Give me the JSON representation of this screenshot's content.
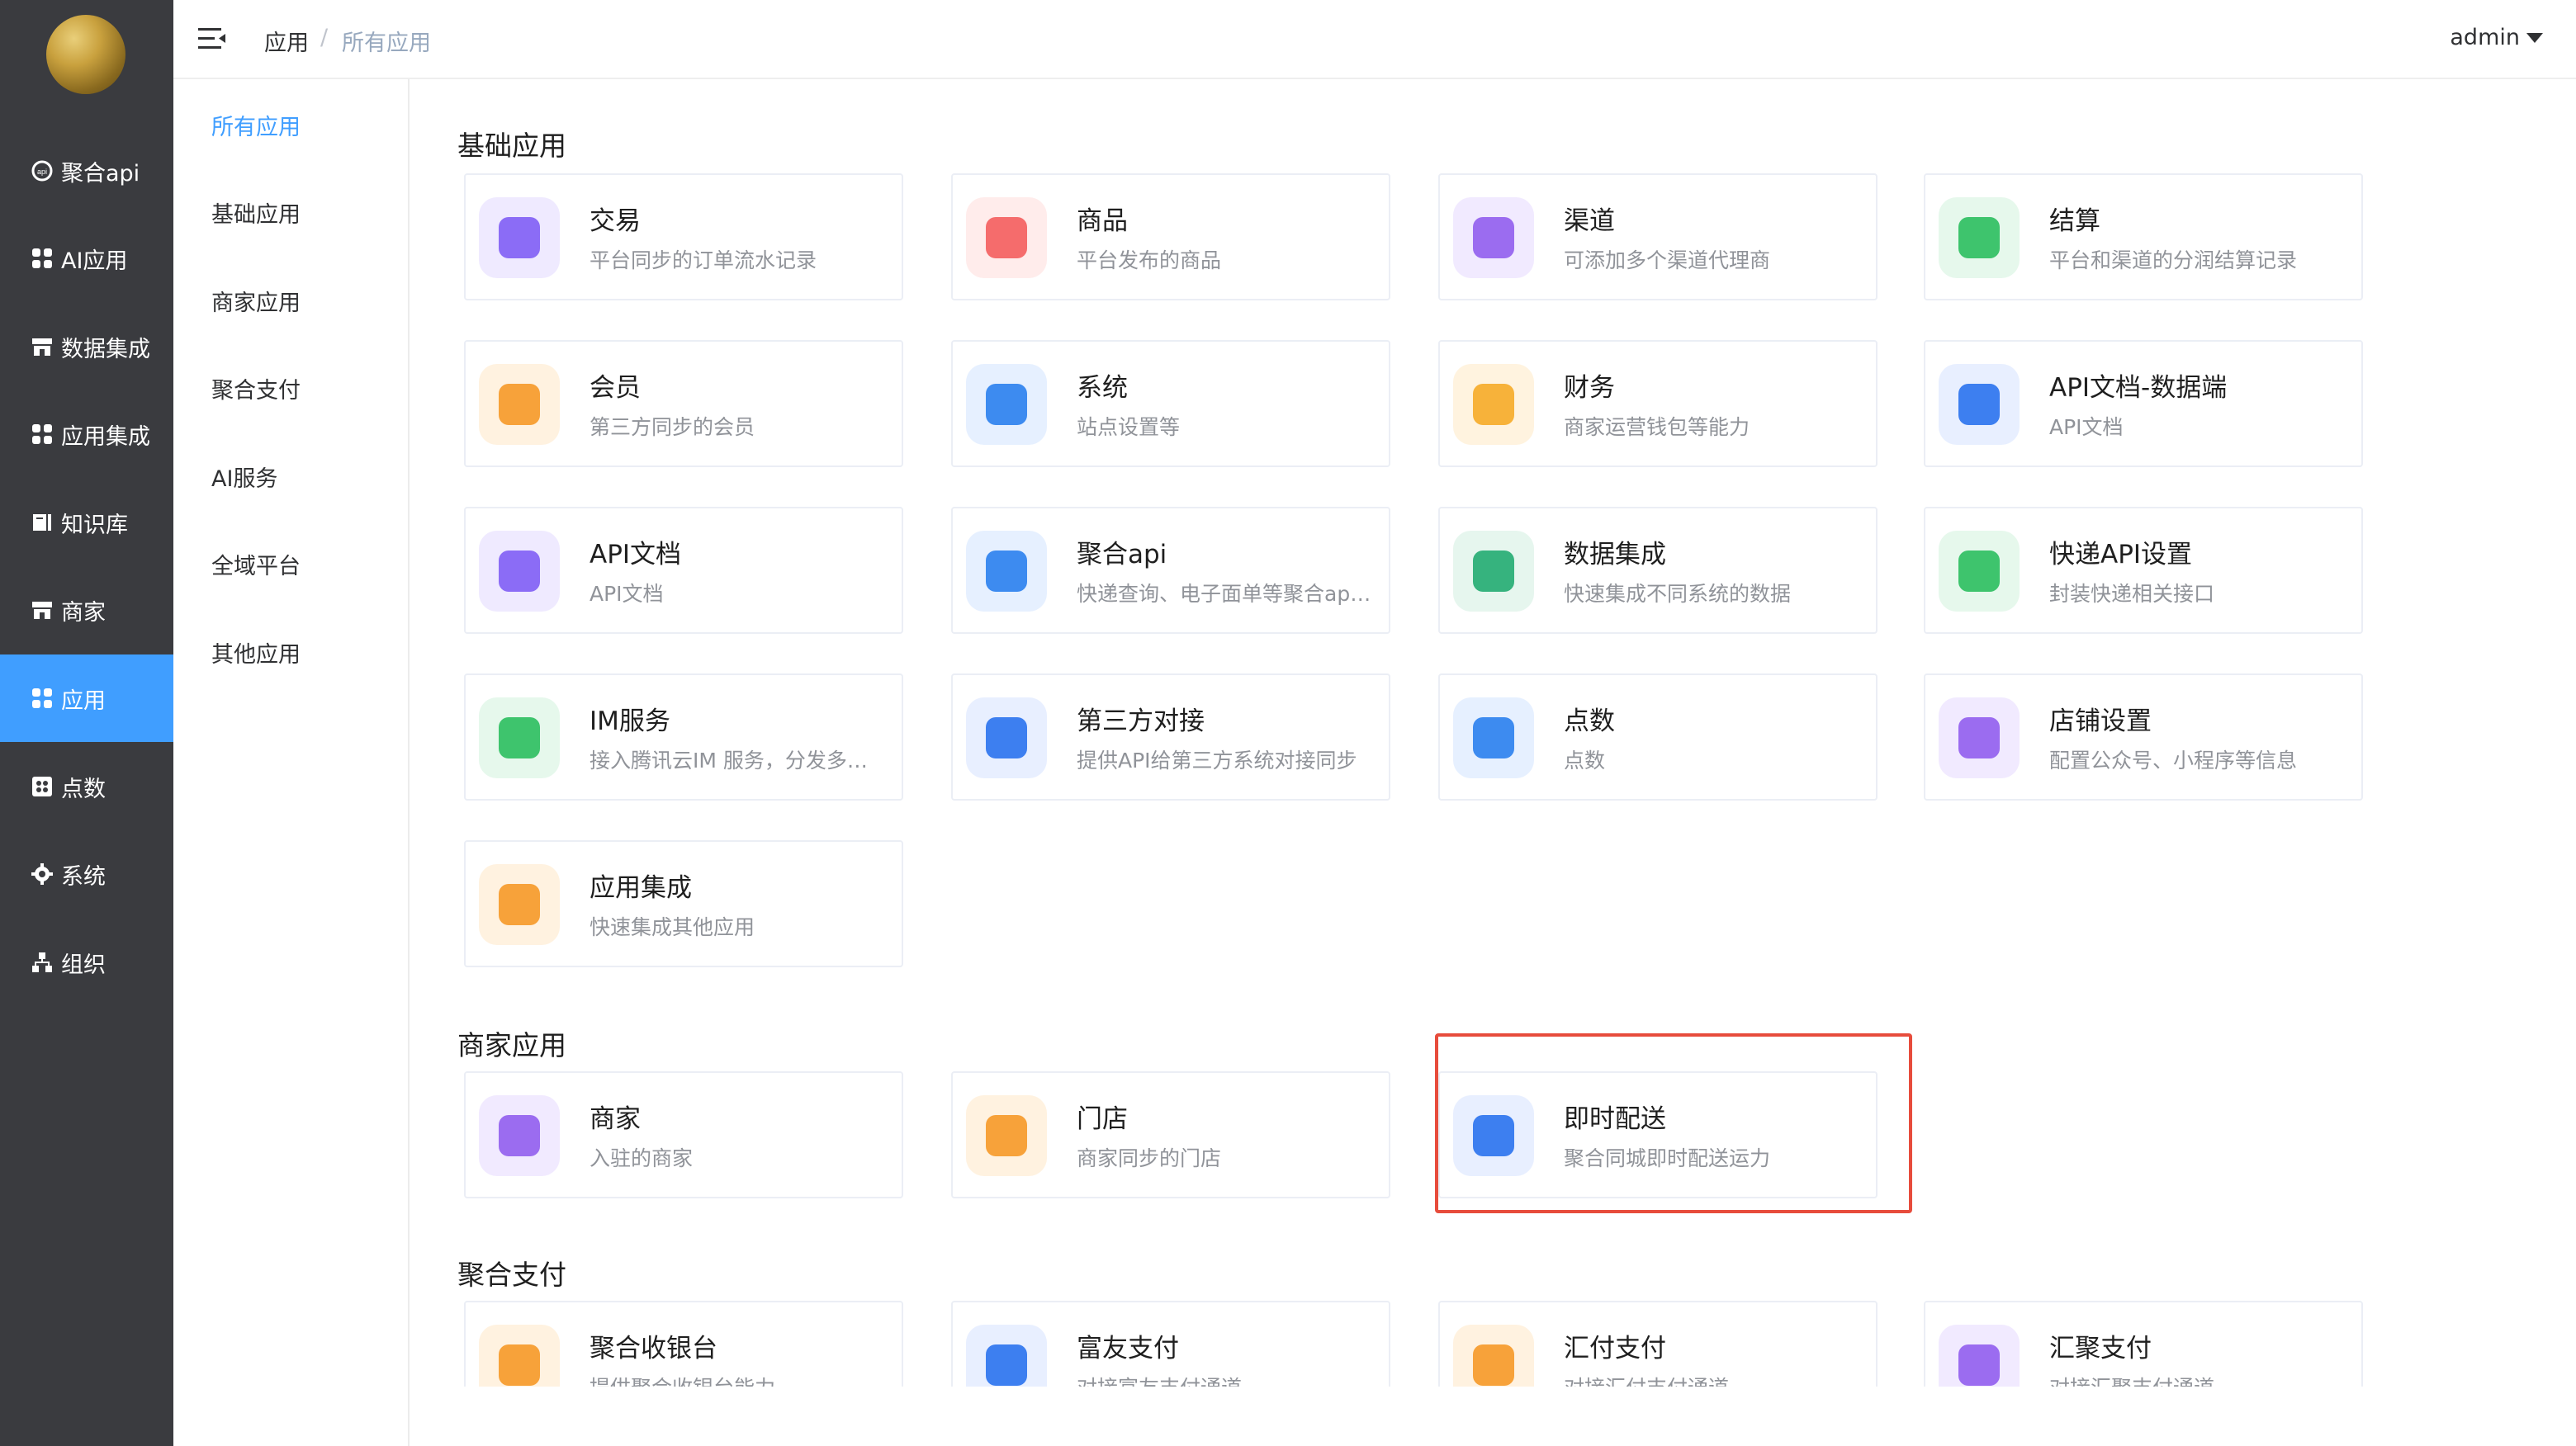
{
  "header": {
    "crumb_root": "应用",
    "crumb_sep": "/",
    "crumb_current": "所有应用",
    "user": "admin"
  },
  "sidebar": [
    {
      "label": "聚合api",
      "icon": "api-icon"
    },
    {
      "label": "AI应用",
      "icon": "grid-icon"
    },
    {
      "label": "数据集成",
      "icon": "store-icon"
    },
    {
      "label": "应用集成",
      "icon": "grid-icon"
    },
    {
      "label": "知识库",
      "icon": "book-icon"
    },
    {
      "label": "商家",
      "icon": "store-icon"
    },
    {
      "label": "应用",
      "icon": "grid-icon"
    },
    {
      "label": "点数",
      "icon": "dots-icon"
    },
    {
      "label": "系统",
      "icon": "gear-icon"
    },
    {
      "label": "组织",
      "icon": "org-icon"
    }
  ],
  "subnav": [
    "所有应用",
    "基础应用",
    "商家应用",
    "聚合支付",
    "AI服务",
    "全域平台",
    "其他应用"
  ],
  "sections": {
    "basic": "基础应用",
    "merchant": "商家应用",
    "pay": "聚合支付"
  },
  "cards": [
    {
      "title": "交易",
      "desc": "平台同步的订单流水记录",
      "color": "#8b6cf6",
      "bg": "#efeaff",
      "icon": "clipboard-icon"
    },
    {
      "title": "商品",
      "desc": "平台发布的商品",
      "color": "#f56c6c",
      "bg": "#ffeceb",
      "icon": "bag-icon"
    },
    {
      "title": "渠道",
      "desc": "可添加多个渠道代理商",
      "color": "#9b6cf0",
      "bg": "#f1eaff",
      "icon": "channels-icon"
    },
    {
      "title": "结算",
      "desc": "平台和渠道的分润结算记录",
      "color": "#3ec46d",
      "bg": "#e6f8ec",
      "icon": "trend-icon"
    },
    {
      "title": "会员",
      "desc": "第三方同步的会员",
      "color": "#f7a23a",
      "bg": "#fff2e0",
      "icon": "member-icon"
    },
    {
      "title": "系统",
      "desc": "站点设置等",
      "color": "#3d8bf0",
      "bg": "#e6f0ff",
      "icon": "gear-icon"
    },
    {
      "title": "财务",
      "desc": "商家运营钱包等能力",
      "color": "#f7b23a",
      "bg": "#fff3df",
      "icon": "wallet-icon"
    },
    {
      "title": "API文档-数据端",
      "desc": "API文档",
      "color": "#3d7ff0",
      "bg": "#e8efff",
      "icon": "api-doc-icon"
    },
    {
      "title": "API文档",
      "desc": "API文档",
      "color": "#8b6cf6",
      "bg": "#efeaff",
      "icon": "api-file-icon"
    },
    {
      "title": "聚合api",
      "desc": "快递查询、电子面单等聚合api能力",
      "color": "#3d8bf0",
      "bg": "#e6f0ff",
      "icon": "api-circle-icon"
    },
    {
      "title": "数据集成",
      "desc": "快速集成不同系统的数据",
      "color": "#36b37e",
      "bg": "#e6f6ee",
      "icon": "data-integration-icon"
    },
    {
      "title": "快递API设置",
      "desc": "封装快递相关接口",
      "color": "#3ec46d",
      "bg": "#e6f8ec",
      "icon": "api-box-icon"
    },
    {
      "title": "IM服务",
      "desc": "接入腾讯云IM 服务，分发多个应用",
      "color": "#3ec46d",
      "bg": "#e6f8ec",
      "icon": "chat-icon"
    },
    {
      "title": "第三方对接",
      "desc": "提供API给第三方系统对接同步",
      "color": "#3d7ff0",
      "bg": "#e8efff",
      "icon": "connect-icon"
    },
    {
      "title": "点数",
      "desc": "点数",
      "color": "#3d8bf0",
      "bg": "#e6f0ff",
      "icon": "dots-icon"
    },
    {
      "title": "店铺设置",
      "desc": "配置公众号、小程序等信息",
      "color": "#9b6cf0",
      "bg": "#f1eaff",
      "icon": "shop-settings-icon"
    },
    {
      "title": "应用集成",
      "desc": "快速集成其他应用",
      "color": "#f7a23a",
      "bg": "#fff2e0",
      "icon": "apps-icon"
    },
    {
      "title": "商家",
      "desc": "入驻的商家",
      "color": "#9b6cf0",
      "bg": "#f1eaff",
      "icon": "merchant-icon"
    },
    {
      "title": "门店",
      "desc": "商家同步的门店",
      "color": "#f7a23a",
      "bg": "#fff2e0",
      "icon": "store-front-icon"
    },
    {
      "title": "即时配送",
      "desc": "聚合同城即时配送运力",
      "color": "#3d7ff0",
      "bg": "#e8efff",
      "icon": "scooter-icon"
    },
    {
      "title": "聚合收银台",
      "desc": "提供聚合收银台能力",
      "color": "#f7a23a",
      "bg": "#fff2e0",
      "icon": "cashier-icon"
    },
    {
      "title": "富友支付",
      "desc": "对接富友支付通道",
      "color": "#3d7ff0",
      "bg": "#e8efff",
      "icon": "fuyou-icon"
    },
    {
      "title": "汇付支付",
      "desc": "对接汇付支付通道",
      "color": "#f7a23a",
      "bg": "#fff2e0",
      "icon": "huifu-icon"
    },
    {
      "title": "汇聚支付",
      "desc": "对接汇聚支付通道",
      "color": "#9b6cf0",
      "bg": "#f1eaff",
      "icon": "huiju-icon"
    }
  ]
}
